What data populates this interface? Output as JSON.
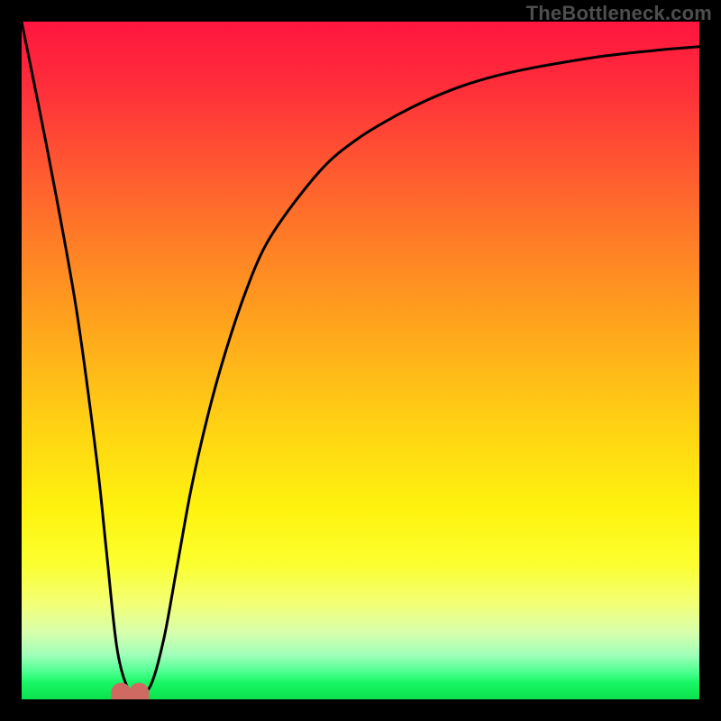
{
  "watermark": "TheBottleneck.com",
  "chart_data": {
    "type": "line",
    "title": "",
    "xlabel": "",
    "ylabel": "",
    "xlim": [
      0,
      100
    ],
    "ylim": [
      0,
      100
    ],
    "grid": false,
    "legend": false,
    "gradient_stops": [
      {
        "pct": 0,
        "color": "#ff153f"
      },
      {
        "pct": 10,
        "color": "#ff2f3a"
      },
      {
        "pct": 22,
        "color": "#ff5a30"
      },
      {
        "pct": 34,
        "color": "#ff8225"
      },
      {
        "pct": 46,
        "color": "#ffa81c"
      },
      {
        "pct": 60,
        "color": "#ffd313"
      },
      {
        "pct": 72,
        "color": "#fef30e"
      },
      {
        "pct": 80,
        "color": "#fbff2f"
      },
      {
        "pct": 86,
        "color": "#f3ff77"
      },
      {
        "pct": 90,
        "color": "#d9ffac"
      },
      {
        "pct": 93.5,
        "color": "#9fffb9"
      },
      {
        "pct": 96,
        "color": "#4bff8f"
      },
      {
        "pct": 97.5,
        "color": "#19f765"
      },
      {
        "pct": 100,
        "color": "#0be24d"
      }
    ],
    "series": [
      {
        "name": "bottleneck-curve",
        "x": [
          0,
          4,
          8,
          11,
          12.5,
          14,
          15.5,
          17,
          19,
          21,
          23,
          25,
          27.5,
          30,
          33,
          36,
          40,
          45,
          50,
          55,
          60,
          65,
          70,
          75,
          80,
          85,
          90,
          95,
          100
        ],
        "y": [
          100,
          80,
          58,
          36,
          22,
          8,
          2,
          1,
          2,
          9,
          20,
          31,
          42,
          51,
          60,
          67,
          73,
          79,
          83,
          86,
          88.5,
          90.5,
          92,
          93.1,
          94,
          94.8,
          95.4,
          95.9,
          96.3
        ]
      }
    ],
    "marker": {
      "name": "minimum-marker",
      "x": 16,
      "y": 1,
      "color": "#cf6a62"
    }
  }
}
